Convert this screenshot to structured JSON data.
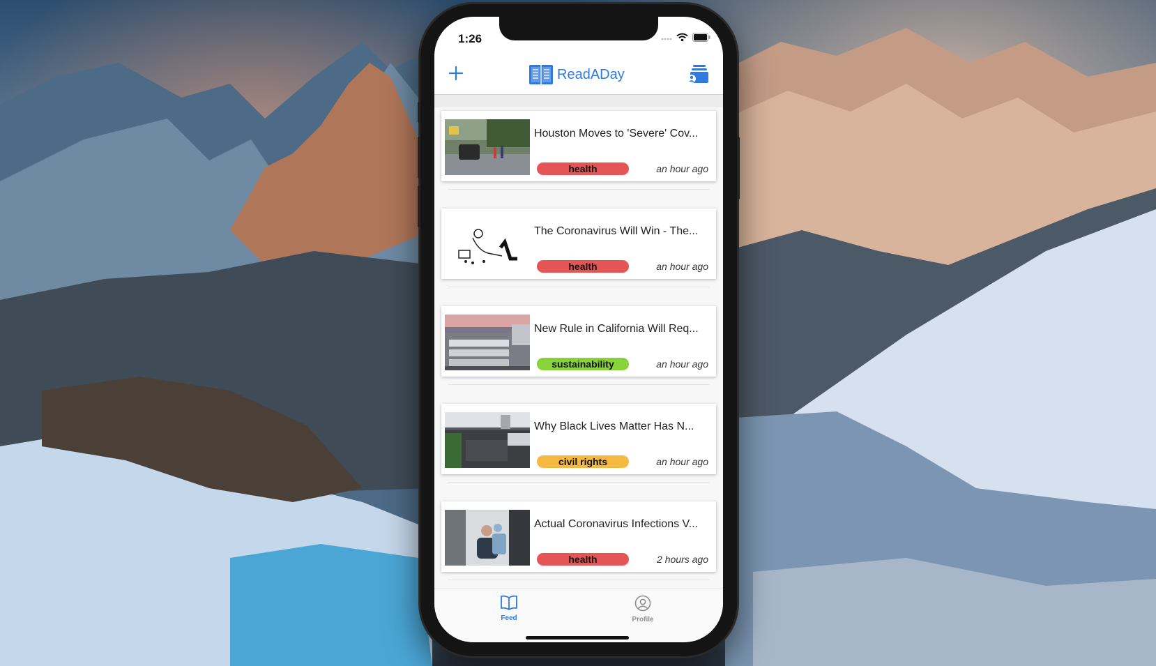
{
  "background": {
    "description_colors": [
      "#2c4d6e",
      "#e6a07a",
      "#c8d7eb"
    ]
  },
  "status_bar": {
    "time": "1:26"
  },
  "nav": {
    "brand_name": "ReadADay",
    "brand_color": "#2f7ae0",
    "add_icon": "plus-icon",
    "right_icon": "profile-stack-icon"
  },
  "feed": {
    "cards": [
      {
        "title": "Houston Moves to 'Severe' Cov...",
        "tag": "health",
        "tag_color": "#e45656",
        "time": "an hour ago",
        "thumb": "street-photo"
      },
      {
        "title": "The Coronavirus Will Win - The...",
        "tag": "health",
        "tag_color": "#e45656",
        "time": "an hour ago",
        "thumb": "illustration"
      },
      {
        "title": "New Rule in California Will Req...",
        "tag": "sustainability",
        "tag_color": "#88d23a",
        "time": "an hour ago",
        "thumb": "trucks-photo"
      },
      {
        "title": "Why Black Lives Matter Has N...",
        "tag": "civil rights",
        "tag_color": "#f5b842",
        "time": "an hour ago",
        "thumb": "crowd-photo"
      },
      {
        "title": "Actual Coronavirus Infections V...",
        "tag": "health",
        "tag_color": "#e45656",
        "time": "2 hours ago",
        "thumb": "medical-photo"
      }
    ]
  },
  "tabbar": {
    "tabs": [
      {
        "label": "Feed",
        "icon": "book-icon",
        "active": true,
        "color": "#2f7ae0"
      },
      {
        "label": "Profile",
        "icon": "person-circle-icon",
        "active": false,
        "color": "#8e8e8e"
      }
    ]
  }
}
